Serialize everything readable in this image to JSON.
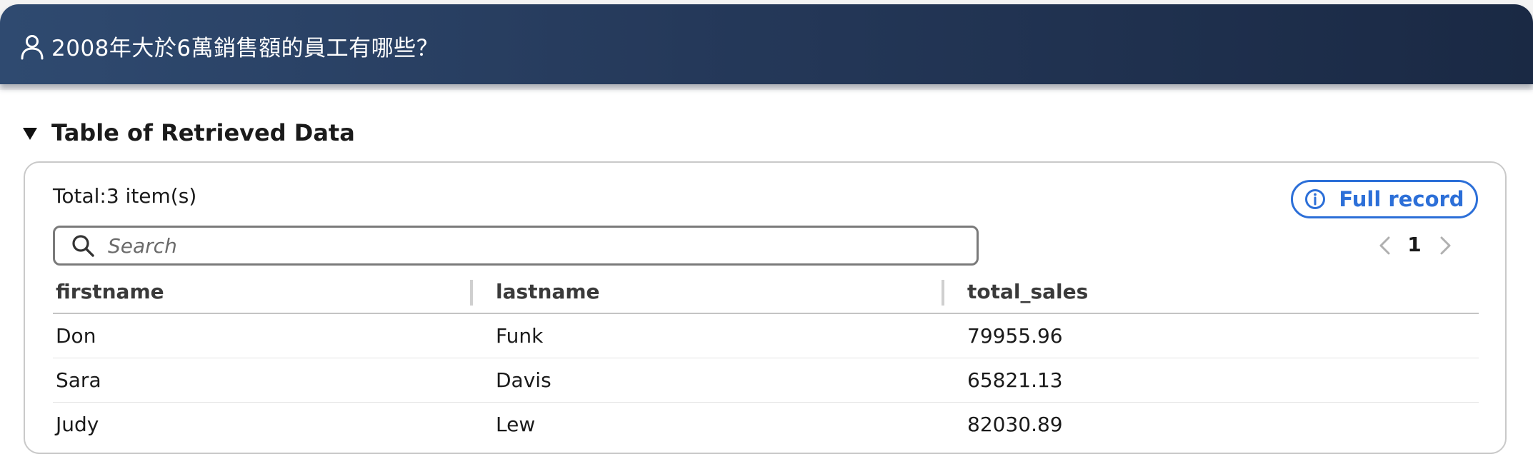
{
  "header": {
    "question": "2008年大於6萬銷售額的員工有哪些？",
    "icon": "user-icon"
  },
  "section": {
    "title": "Table of Retrieved Data",
    "expanded": true
  },
  "table_panel": {
    "total_label": "Total:3 item(s)",
    "full_record_label": "Full record",
    "search_placeholder": "Search",
    "search_value": "",
    "pagination": {
      "current_page": "1"
    },
    "columns": [
      "firstname",
      "lastname",
      "total_sales"
    ],
    "rows": [
      [
        "Don",
        "Funk",
        "79955.96"
      ],
      [
        "Sara",
        "Davis",
        "65821.13"
      ],
      [
        "Judy",
        "Lew",
        "82030.89"
      ]
    ]
  },
  "colors": {
    "header_bg": "#25395a",
    "accent": "#2c6fd8"
  }
}
